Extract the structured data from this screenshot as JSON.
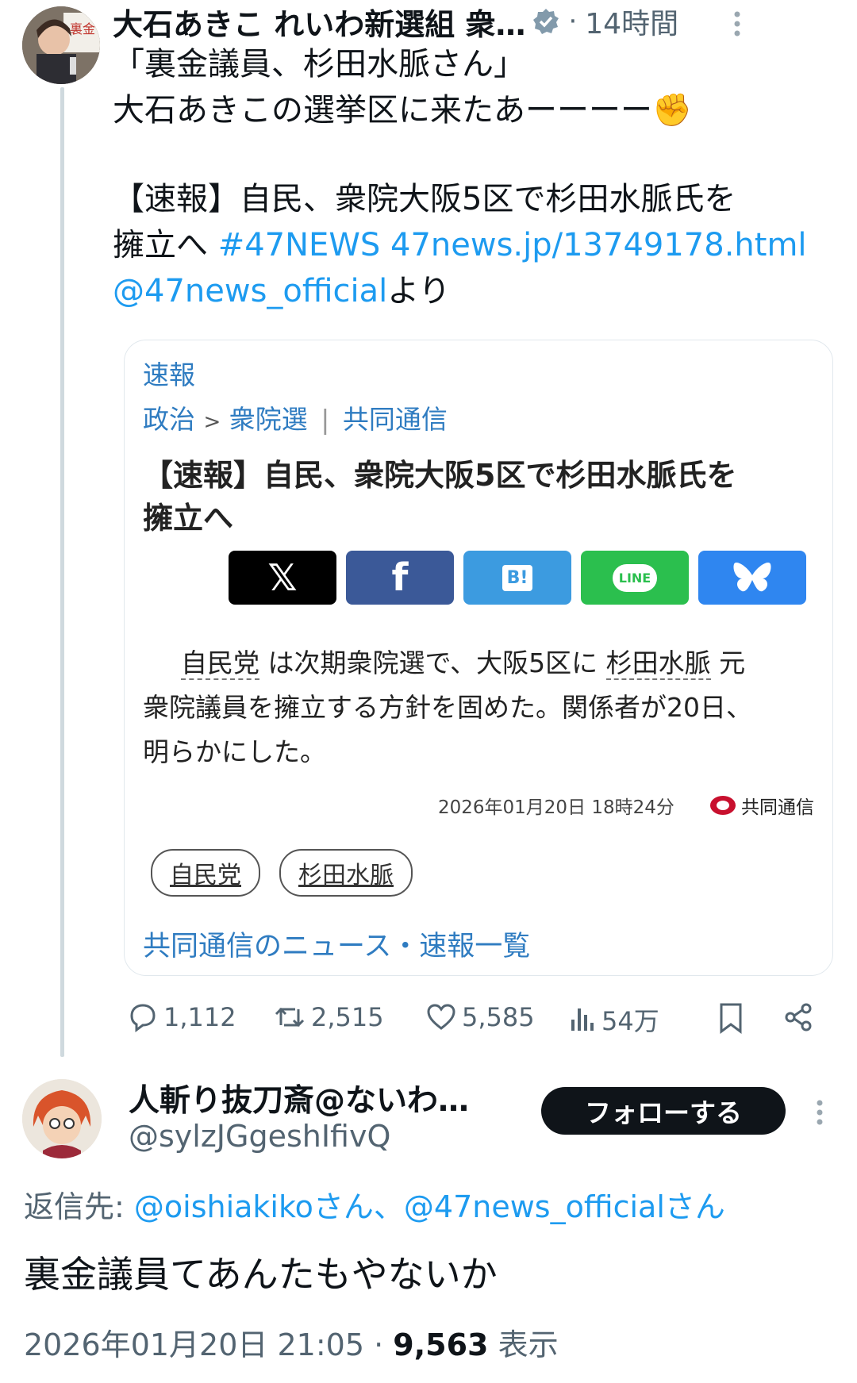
{
  "tweet1": {
    "author_name": "大石あきこ れいわ新選組 衆…",
    "time_sep": "·",
    "time": "14時間",
    "line1": "「裏金議員、杉田水脈さん」",
    "line2": "大石あきこの選挙区に来たあーーーー✊",
    "line3": "【速報】自民、衆院大阪5区で杉田水脈氏を",
    "line4_text": "擁立へ ",
    "hashtag": "#47NEWS",
    "url": "47news.jp/13749178.html",
    "mention": "@47news_official",
    "mention_suffix": "より",
    "avatar_sign": "裏金"
  },
  "card": {
    "label": "速報",
    "crumb_politics": "政治",
    "crumb_sep": ">",
    "crumb_election": "衆院選",
    "crumb_divider": "|",
    "crumb_source": "共同通信",
    "headline_1": "【速報】自民、衆院大阪5区で杉田水脈氏を",
    "headline_2": "擁立へ",
    "share": {
      "x": "𝕏",
      "facebook": "f",
      "hatena": "B!",
      "line": "LINE",
      "bluesky": "🦋"
    },
    "body_link1": "自民党",
    "body_text1": " は次期衆院選で、大阪5区に ",
    "body_link2": "杉田水脈",
    "body_text2": " 元",
    "body_line2": "衆院議員を擁立する方針を固めた。関係者が20日、",
    "body_line3": "明らかにした。",
    "timestamp": "2026年01月20日 18時24分",
    "source": "共同通信",
    "tags": [
      "自民党",
      "杉田水脈"
    ],
    "news_list_link": "共同通信のニュース・速報一覧"
  },
  "actions": {
    "replies": "1,112",
    "reposts": "2,515",
    "likes": "5,585",
    "views": "54万"
  },
  "reply": {
    "author_name": "人斬り抜刀斎@ないわ…",
    "handle": "@sylzJGgeshIfivQ",
    "follow_label": "フォローする",
    "reply_to_prefix": "返信先: ",
    "reply_to_1": "@oishiakikoさん",
    "reply_sep": "、",
    "reply_to_2": "@47news_officialさん",
    "text": "裏金議員てあんたもやないか",
    "date": "2026年01月20日 21:05",
    "dot": "·",
    "views": "9,563",
    "views_label": "表示"
  },
  "colors": {
    "link": "#1d9bf0",
    "card_link": "#2f7cc1",
    "verified": "#829aab",
    "x_btn": "#000000",
    "facebook": "#3b5998",
    "hatena": "#3c9be0",
    "line": "#2bbf4e",
    "bluesky": "#2f86f0"
  }
}
